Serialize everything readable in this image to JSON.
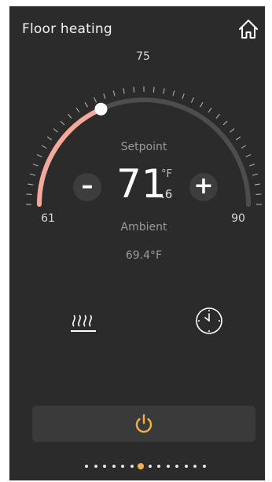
{
  "header": {
    "title": "Floor heating",
    "home_icon": "home-icon"
  },
  "dial": {
    "min_label": "61",
    "mid_label": "75",
    "max_label": "90",
    "min": 61,
    "max": 90,
    "setpoint_value": 71.6,
    "active_color": "#f4a99a",
    "track_color": "#4d4d4d"
  },
  "setpoint": {
    "label": "Setpoint",
    "whole": "71",
    "fraction": ".6",
    "unit": "°F",
    "minus_label": "–",
    "plus_label": "+"
  },
  "ambient": {
    "label": "Ambient",
    "value": "69.4°F"
  },
  "modes": {
    "heat_icon": "floor-heating-icon",
    "schedule_icon": "clock-icon"
  },
  "power": {
    "icon": "power-icon",
    "color": "#f0b24a"
  },
  "pager": {
    "count": 14,
    "active_index": 6
  }
}
